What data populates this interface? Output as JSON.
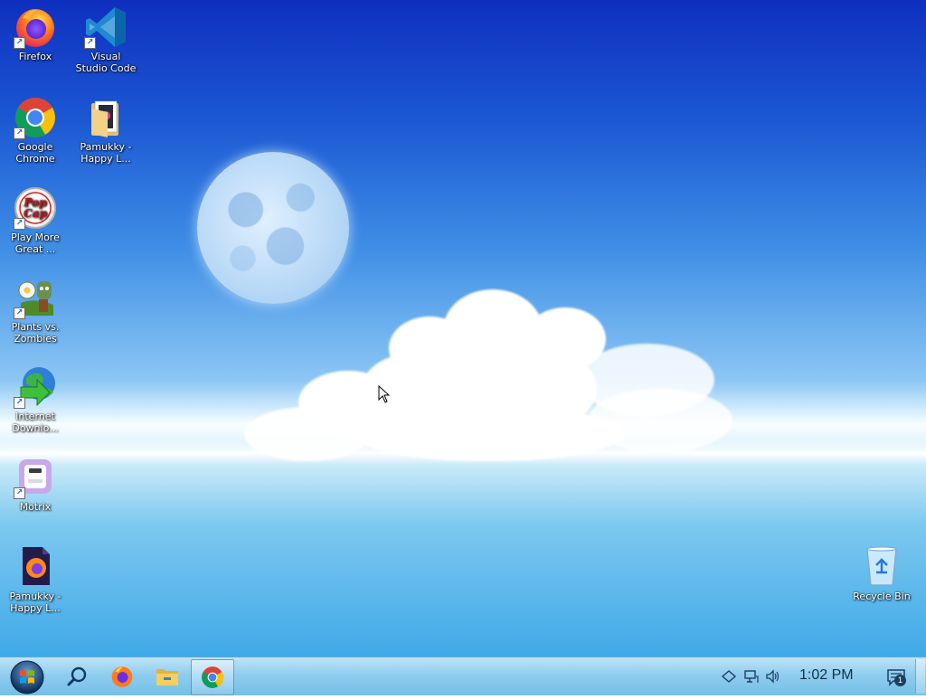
{
  "desktop": {
    "icons": [
      {
        "label": "Firefox"
      },
      {
        "label": "Visual Studio Code"
      },
      {
        "label": "Google Chrome"
      },
      {
        "label": "Pamukky - Happy L..."
      },
      {
        "label": "Play More Great ..."
      },
      {
        "label": "Plants vs. Zombies"
      },
      {
        "label": "Internet Downlo..."
      },
      {
        "label": "Motrix"
      },
      {
        "label": "Pamukky - Happy L..."
      },
      {
        "label": "Recycle Bin"
      }
    ],
    "popcap_text": "Pop Cap"
  },
  "taskbar": {
    "pinned": [
      "start-icon",
      "search-icon",
      "firefox-icon",
      "file-explorer-icon",
      "chrome-icon"
    ],
    "active_app": "chrome-icon",
    "clock": "1:02 PM",
    "notification_count": "1"
  },
  "colors": {
    "taskbar": "#8fcdef",
    "sky_top": "#0f2fbf",
    "sea": "#3fa9e8"
  }
}
